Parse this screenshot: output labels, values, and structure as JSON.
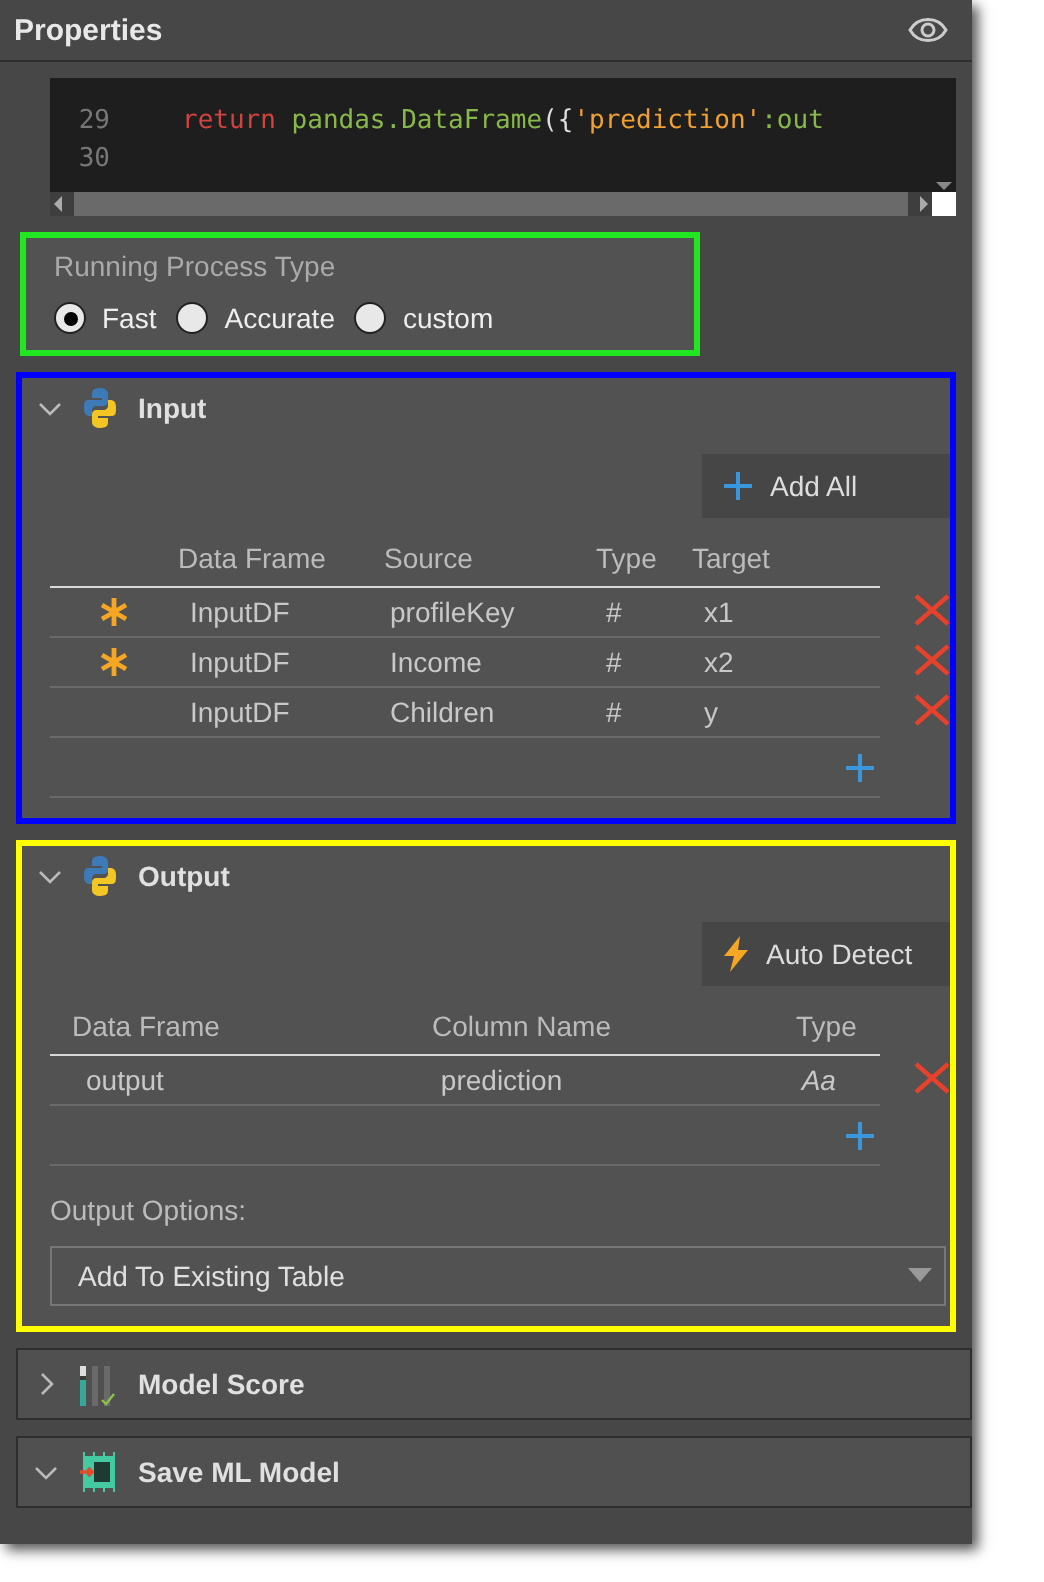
{
  "panel": {
    "title": "Properties"
  },
  "code": {
    "lines": [
      {
        "number": "29",
        "tokens": [
          {
            "kind": "keyword",
            "text": "return"
          },
          {
            "kind": "name",
            "text": " pandas.DataFrame"
          },
          {
            "kind": "punct",
            "text": "({"
          },
          {
            "kind": "string",
            "text": "'prediction'"
          },
          {
            "kind": "name",
            "text": ":out"
          }
        ]
      },
      {
        "number": "30"
      }
    ]
  },
  "process_type": {
    "label": "Running Process Type",
    "color": "#22e622",
    "options": [
      {
        "label": "Fast",
        "selected": true
      },
      {
        "label": "Accurate",
        "selected": false
      },
      {
        "label": "custom",
        "selected": false
      }
    ]
  },
  "input": {
    "title": "Input",
    "expanded": true,
    "color": "#0000ff",
    "add_all": "Add All",
    "columns": [
      "Data Frame",
      "Source",
      "Type",
      "Target"
    ],
    "rows": [
      {
        "required": true,
        "data_frame": "InputDF",
        "source": "profileKey",
        "type": "#",
        "target": "x1"
      },
      {
        "required": true,
        "data_frame": "InputDF",
        "source": "Income",
        "type": "#",
        "target": "x2"
      },
      {
        "required": false,
        "data_frame": "InputDF",
        "source": "Children",
        "type": "#",
        "target": "y"
      }
    ]
  },
  "output": {
    "title": "Output",
    "expanded": true,
    "color": "#ffff00",
    "auto_detect": "Auto Detect",
    "columns": [
      "Data Frame",
      "Column Name",
      "Type"
    ],
    "rows": [
      {
        "data_frame": "output",
        "column_name": "prediction",
        "type": "Aa"
      }
    ],
    "options_label": "Output Options:",
    "options_value": "Add To Existing Table"
  },
  "sections": [
    {
      "kind": "score",
      "title": "Model Score",
      "expanded": false
    },
    {
      "kind": "ai",
      "title": "Save ML Model",
      "expanded": true
    }
  ]
}
